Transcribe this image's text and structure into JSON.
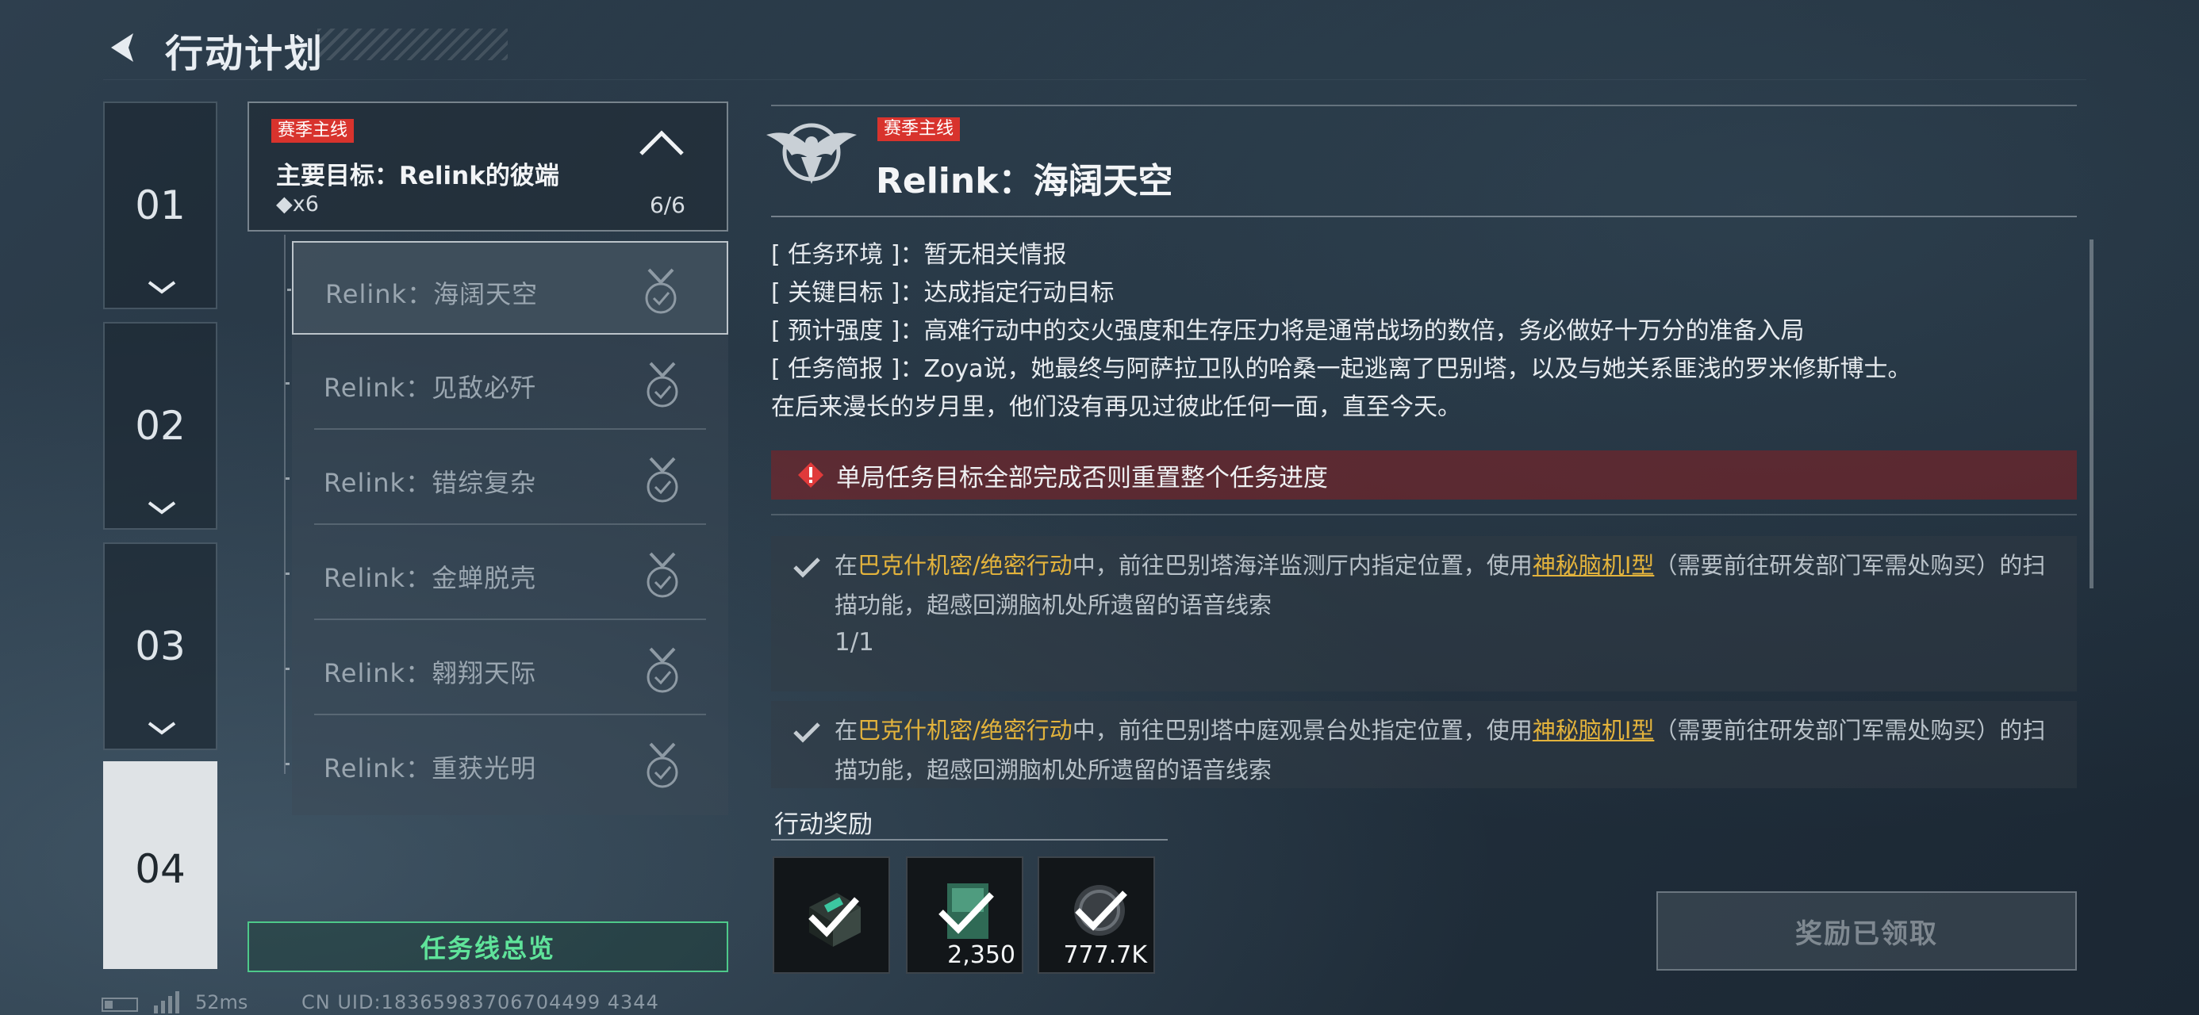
{
  "header": {
    "title": "行动计划"
  },
  "chapters": [
    {
      "label": "01",
      "active": false
    },
    {
      "label": "02",
      "active": false
    },
    {
      "label": "03",
      "active": false
    },
    {
      "label": "04",
      "active": true
    }
  ],
  "quest_header": {
    "tag": "赛季主线",
    "title": "主要目标：Relink的彼端",
    "reward": "◆x6",
    "progress": "6/6"
  },
  "quest_items": [
    {
      "label": "Relink：海阔天空",
      "selected": true
    },
    {
      "label": "Relink：见敌必歼",
      "selected": false
    },
    {
      "label": "Relink：错综复杂",
      "selected": false
    },
    {
      "label": "Relink：金蝉脱壳",
      "selected": false
    },
    {
      "label": "Relink：翱翔天际",
      "selected": false
    },
    {
      "label": "Relink：重获光明",
      "selected": false
    }
  ],
  "overview_button": "任务线总览",
  "detail": {
    "tag": "赛季主线",
    "title": "Relink：海阔天空",
    "info": [
      {
        "key": "[ 任务环境 ]：",
        "value": "暂无相关情报"
      },
      {
        "key": "[ 关键目标 ]：",
        "value": "达成指定行动目标"
      },
      {
        "key": "[ 预计强度 ]：",
        "value": "高难行动中的交火强度和生存压力将是通常战场的数倍，务必做好十万分的准备入局"
      },
      {
        "key": "[ 任务简报 ]：",
        "value": "Zoya说，她最终与阿萨拉卫队的哈桑一起逃离了巴别塔，以及与她关系匪浅的罗米修斯博士。"
      }
    ],
    "info_continuation": "在后来漫长的岁月里，他们没有再见过彼此任何一面，直至今天。",
    "warning": "单局任务目标全部完成否则重置整个任务进度",
    "objectives": [
      {
        "prefix": "在",
        "mode": "巴克什机密/绝密行动",
        "middle": "中，前往巴别塔海洋监测厅内指定位置，使用",
        "item": "神秘脑机Ⅰ型",
        "suffix": "（需要前往研发部门军需处购买）的扫描功能，超感回溯脑机处所遗留的语音线索",
        "count": "1/1"
      },
      {
        "prefix": "在",
        "mode": "巴克什机密/绝密行动",
        "middle": "中，前往巴别塔中庭观景台处指定位置，使用",
        "item": "神秘脑机Ⅰ型",
        "suffix": "（需要前往研发部门军需处购买）的扫描功能，超感回溯脑机处所遗留的语音线索",
        "count": ""
      }
    ]
  },
  "rewards": {
    "title": "行动奖励",
    "items": [
      {
        "icon": "crate-icon",
        "qty": ""
      },
      {
        "icon": "card-icon",
        "qty": "2,350"
      },
      {
        "icon": "currency-coin-icon",
        "qty": "777.7K"
      }
    ],
    "claim_button": "奖励已领取"
  },
  "footer": {
    "ping": "52ms",
    "uid": "CN UID:18365983706704499 4344"
  },
  "colors": {
    "accent_green": "#4ec98a",
    "tag_red": "#d8332d",
    "highlight_yellow": "#e3b33c"
  }
}
